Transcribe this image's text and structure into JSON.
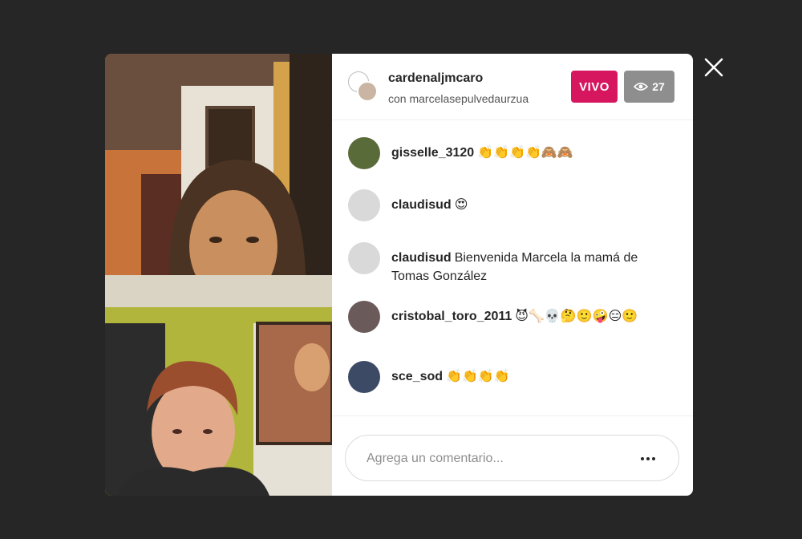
{
  "broadcast": {
    "host_username": "cardenaljmcaro",
    "guest_line": "con marcelasepulvedaurzua",
    "live_label": "VIVO",
    "viewer_count": "27",
    "viewer_icon": "eye-icon"
  },
  "comments": [
    {
      "username": "gisselle_3120",
      "text": "👏👏👏👏🙈🙈",
      "avatar_color": "#5a6b3a"
    },
    {
      "username": "claudisud",
      "text": "😍",
      "avatar_color": "#d9d9d9"
    },
    {
      "username": "claudisud",
      "text": "Bienvenida Marcela la mamá de Tomas González",
      "avatar_color": "#d9d9d9"
    },
    {
      "username": "cristobal_toro_2011",
      "text": "😈🦴💀🤔🙂🤪😑🙂",
      "avatar_color": "#6b5a5a"
    },
    {
      "username": "sce_sod",
      "text": "👏👏👏👏",
      "avatar_color": "#3d4a66"
    }
  ],
  "composer": {
    "placeholder": "Agrega un comentario...",
    "more_icon": "more-dots-icon"
  },
  "close_icon": "close-icon",
  "colors": {
    "backdrop": "#262626",
    "live": "#d6175f",
    "viewers": "#8e8e8e"
  }
}
